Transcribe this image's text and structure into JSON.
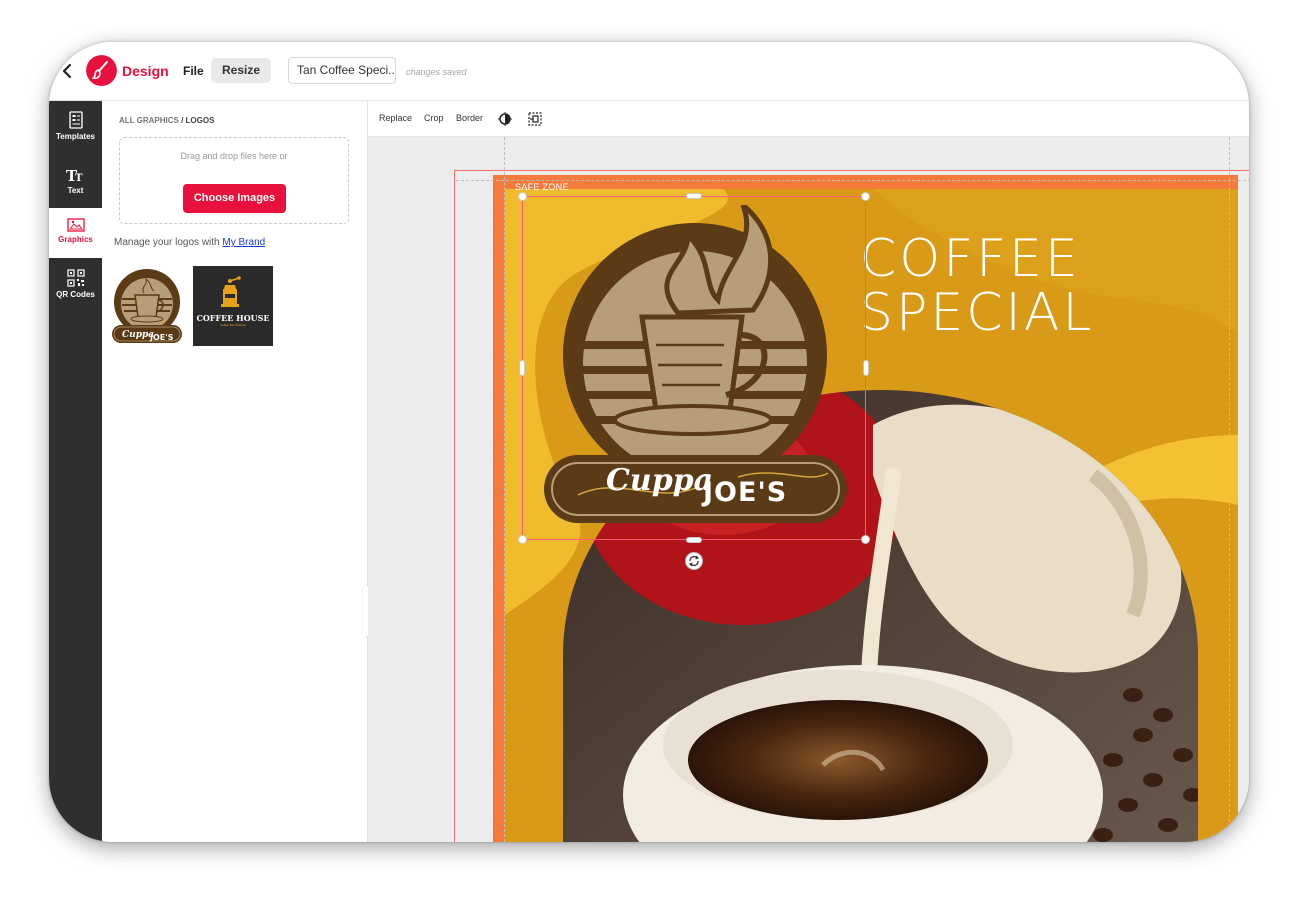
{
  "header": {
    "app_name": "Design",
    "menu_file": "File",
    "menu_resize": "Resize",
    "document_title": "Tan Coffee Speci...",
    "save_status": "changes saved"
  },
  "rail": {
    "items": [
      {
        "label": "Templates",
        "icon": "templates-icon"
      },
      {
        "label": "Text",
        "icon": "text-icon"
      },
      {
        "label": "Graphics",
        "icon": "graphics-icon",
        "active": true
      },
      {
        "label": "QR Codes",
        "icon": "qr-code-icon"
      }
    ]
  },
  "panel": {
    "breadcrumb_root": "ALL GRAPHICS",
    "breadcrumb_current": "/ LOGOS",
    "drop_text": "Drag and drop files here or",
    "choose_button": "Choose Images",
    "manage_text": "Manage your logos with",
    "manage_link": "My Brand",
    "logos": [
      {
        "name": "Cuppa Joe's",
        "text_a": "Cuppa",
        "text_b": "JOE'S"
      },
      {
        "name": "Coffee House",
        "text_a": "COFFEE HOUSE",
        "text_b": "Coffee Tea Pastries"
      }
    ]
  },
  "toolbar": {
    "replace": "Replace",
    "crop": "Crop",
    "border": "Border"
  },
  "canvas": {
    "safe_zone_label": "SAFE ZONE",
    "headline_line1": "COFFEE",
    "headline_line2": "SPECIAL",
    "logo_text_a": "Cuppa",
    "logo_text_b": "JOE'S"
  },
  "colors": {
    "brand_red": "#e8103c",
    "poster_gold": "#d99a17",
    "poster_yellow": "#f3c233",
    "poster_orange": "#f47b3c",
    "logo_brown": "#5b3a16",
    "logo_tan": "#b79e77",
    "rail_dark": "#2f2f2f"
  }
}
